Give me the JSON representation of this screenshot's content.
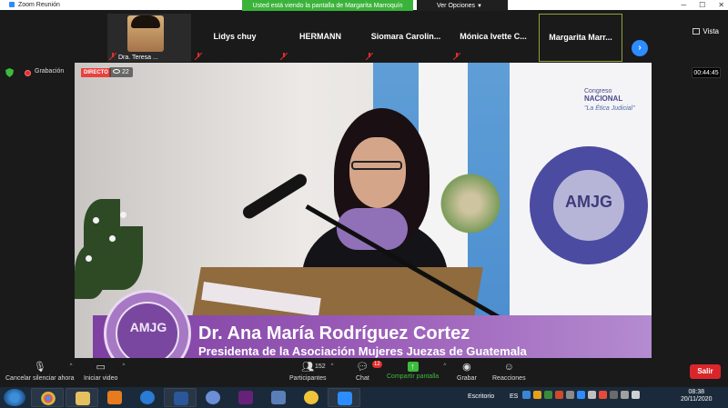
{
  "window": {
    "title": "Zoom Reunión",
    "controls": [
      "─",
      "☐",
      "✕"
    ]
  },
  "share_banner": "Usted está viendo la pantalla de Margarita Marroquín",
  "view_options": "Ver Opciones",
  "view_button": "Vista",
  "participants_strip": [
    {
      "name": "Dra. Teresa ...",
      "video": true
    },
    {
      "name": "Lidys chuy",
      "video": false
    },
    {
      "name": "HERMANN",
      "video": false
    },
    {
      "name": "Siomara  Carolin...",
      "video": false
    },
    {
      "name": "Mónica Ivette  C...",
      "video": false
    },
    {
      "name": "Margarita  Marr...",
      "video": false,
      "active": true
    }
  ],
  "next_arrow": "›",
  "recording_label": "Grabación",
  "timer": "00:44:45",
  "stream": {
    "live_badge": "DIRECTO",
    "viewer_count": "22",
    "congress_line1": "Congreso",
    "congress_line2": "NACIONAL",
    "congress_line3": "\"La Ética Judicial\"",
    "logo_text": "AMJG",
    "speaker_name": "Dr. Ana María Rodríguez Cortez",
    "speaker_role": "Presidenta de la Asociación Mujeres Juezas de Guatemala"
  },
  "toolbar": {
    "unmute": "Cancelar silenciar ahora",
    "start_video": "Iniciar video",
    "participants": "Participantes",
    "participants_count": "152",
    "chat": "Chat",
    "chat_badge": "12",
    "share_screen": "Compartir pantalla",
    "record": "Grabar",
    "reactions": "Reacciones",
    "leave": "Salir"
  },
  "taskbar": {
    "escritorio": "Escritorio",
    "lang": "ES",
    "time": "08:38",
    "date": "20/11/2020"
  },
  "colors": {
    "zoom_blue": "#2d8cff",
    "share_green": "#3bb33b",
    "leave_red": "#d9262b"
  }
}
